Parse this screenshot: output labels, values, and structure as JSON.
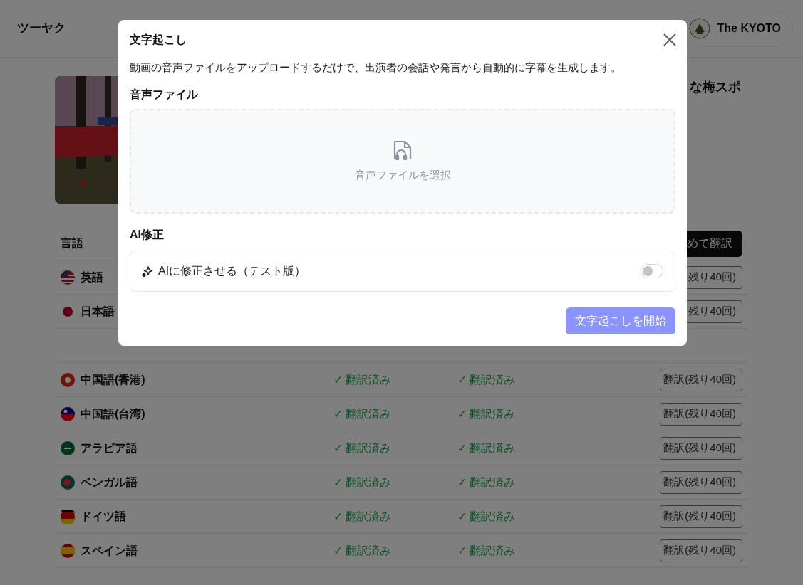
{
  "header": {
    "logo": "ツーヤク",
    "account": "The KYOTO"
  },
  "video": {
    "title_fragment": "な梅スポ"
  },
  "table": {
    "columns": [
      "言語"
    ],
    "bulk_button": "めて翻訳",
    "rows_above": [
      {
        "language": "英語",
        "button": "残り40回)"
      },
      {
        "language": "日本語",
        "button": "残り40回)"
      }
    ],
    "rows": [
      {
        "language": "中国語(香港)",
        "status_1": "✓ 翻訳済み",
        "status_2": "✓ 翻訳済み",
        "button": "翻訳(残り40回)"
      },
      {
        "language": "中国語(台湾)",
        "status_1": "✓ 翻訳済み",
        "status_2": "✓ 翻訳済み",
        "button": "翻訳(残り40回)"
      },
      {
        "language": "アラビア語",
        "status_1": "✓ 翻訳済み",
        "status_2": "✓ 翻訳済み",
        "button": "翻訳(残り40回)"
      },
      {
        "language": "ベンガル語",
        "status_1": "✓ 翻訳済み",
        "status_2": "✓ 翻訳済み",
        "button": "翻訳(残り40回)"
      },
      {
        "language": "ドイツ語",
        "status_1": "✓ 翻訳済み",
        "status_2": "✓ 翻訳済み",
        "button": "翻訳(残り40回)"
      },
      {
        "language": "スペイン語",
        "status_1": "✓ 翻訳済み",
        "status_2": "✓ 翻訳済み",
        "button": "翻訳(残り40回)"
      }
    ]
  },
  "dialog": {
    "title": "文字起こし",
    "description": "動画の音声ファイルをアップロードするだけで、出演者の会話や発言から自動的に字幕を生成します。",
    "audio_label": "音声ファイル",
    "upload_text": "音声ファイルを選択",
    "ai_label": "AI修正",
    "ai_option": {
      "label": "AIに修正させる（テスト版）",
      "on": false
    },
    "submit": {
      "label": "文字起こしを開始",
      "disabled": true
    }
  }
}
